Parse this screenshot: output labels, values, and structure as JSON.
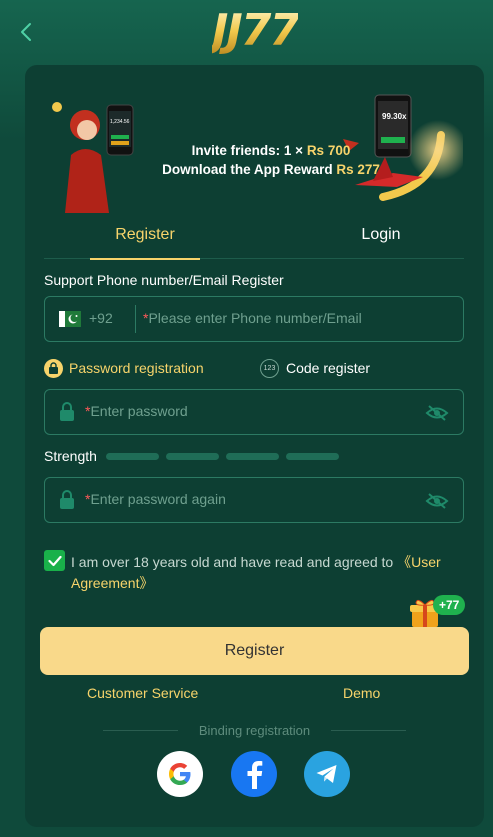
{
  "header": {
    "logo_text": "JJ77"
  },
  "banner": {
    "line1_prefix": "Invite friends: 1 × ",
    "line1_amount": "Rs 700",
    "line2_prefix": "Download the App Reward ",
    "line2_amount": "Rs 277",
    "phone_left_screen": "1,234.56",
    "phone_right_screen": "99.30x"
  },
  "tabs": [
    {
      "label": "Register",
      "active": true
    },
    {
      "label": "Login",
      "active": false
    }
  ],
  "form": {
    "section_label": "Support Phone number/Email Register",
    "country_code": "+92",
    "phone_placeholder": "Please enter Phone number/Email",
    "required_mark": "*",
    "mode_password_label": "Password registration",
    "mode_code_label": "Code register",
    "mode_code_badge": "123",
    "password_placeholder": "Enter password",
    "strength_label": "Strength",
    "strength_segments": 4,
    "password_again_placeholder": "Enter password again",
    "agree_text": "I am over 18 years old and have read and agreed to ",
    "agree_link": "《User Agreement》",
    "agree_checked": true,
    "register_button": "Register",
    "bonus_badge": "+77"
  },
  "links": {
    "customer_service": "Customer Service",
    "demo": "Demo"
  },
  "binding": {
    "label": "Binding registration",
    "providers": [
      "google-icon",
      "facebook-icon",
      "telegram-icon"
    ]
  },
  "colors": {
    "background": "#0f4a3b",
    "panel": "#0d3f33",
    "accent_gold": "#f7d46b",
    "button": "#f9d98a",
    "field_border": "#2c7a63",
    "check_green": "#19b14a"
  }
}
